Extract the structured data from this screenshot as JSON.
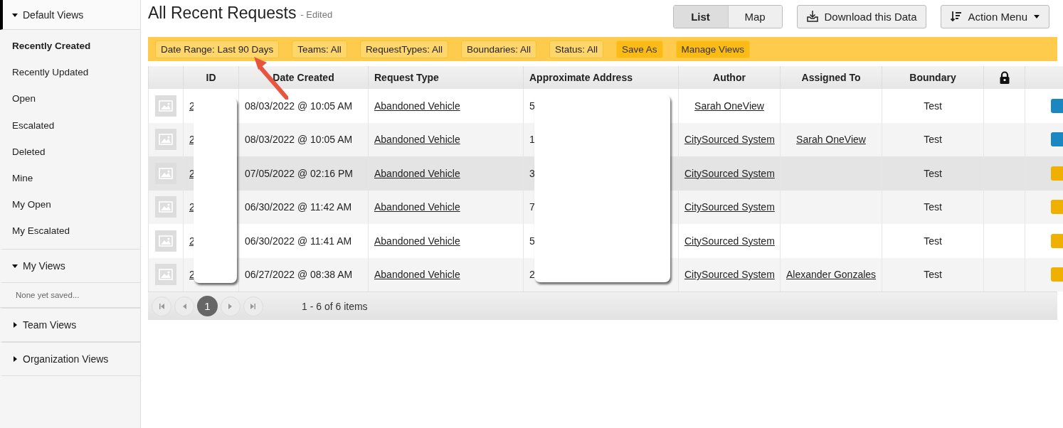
{
  "sidebar": {
    "sections": [
      {
        "title": "Default Views",
        "expanded": true,
        "active": true,
        "items": [
          {
            "label": "Recently Created",
            "selected": true
          },
          {
            "label": "Recently Updated",
            "selected": false
          },
          {
            "label": "Open",
            "selected": false
          },
          {
            "label": "Escalated",
            "selected": false
          },
          {
            "label": "Deleted",
            "selected": false
          },
          {
            "label": "Mine",
            "selected": false
          },
          {
            "label": "My Open",
            "selected": false
          },
          {
            "label": "My Escalated",
            "selected": false
          }
        ]
      },
      {
        "title": "My Views",
        "expanded": true,
        "active": false,
        "empty_text": "None yet saved..."
      },
      {
        "title": "Team Views",
        "expanded": false,
        "active": false
      },
      {
        "title": "Organization Views",
        "expanded": false,
        "active": false
      }
    ]
  },
  "header": {
    "title": "All Recent Requests",
    "subtitle": "- Edited",
    "view_toggle": [
      {
        "label": "List",
        "selected": true
      },
      {
        "label": "Map",
        "selected": false
      }
    ],
    "download_button": "Download this Data",
    "action_menu": "Action Menu"
  },
  "filters": [
    {
      "label": "Date Range: Last 90 Days",
      "kind": "filter"
    },
    {
      "label": "Teams: All",
      "kind": "filter"
    },
    {
      "label": "RequestTypes: All",
      "kind": "filter"
    },
    {
      "label": "Boundaries: All",
      "kind": "filter"
    },
    {
      "label": "Status: All",
      "kind": "filter"
    },
    {
      "label": "Save As",
      "kind": "action"
    },
    {
      "label": "Manage Views",
      "kind": "action"
    }
  ],
  "table": {
    "columns": [
      {
        "kind": "blank"
      },
      {
        "kind": "text",
        "label": "ID"
      },
      {
        "kind": "text",
        "label": "Date Created"
      },
      {
        "kind": "text",
        "label": "Request Type"
      },
      {
        "kind": "text",
        "label": "Approximate Address"
      },
      {
        "kind": "text",
        "label": "Author"
      },
      {
        "kind": "text",
        "label": "Assigned To"
      },
      {
        "kind": "text",
        "label": "Boundary"
      },
      {
        "kind": "lock"
      },
      {
        "kind": "blank"
      }
    ],
    "rows": [
      {
        "id": "2",
        "date_created": "08/03/2022 @ 10:05 AM",
        "request_type": "Abandoned Vehicle",
        "address": "5",
        "author": "Sarah OneView",
        "assigned_to": "",
        "boundary": "Test",
        "color": "#1a87c0",
        "hovered": false
      },
      {
        "id": "2",
        "date_created": "08/03/2022 @ 10:05 AM",
        "request_type": "Abandoned Vehicle",
        "address": "1",
        "author": "CitySourced System",
        "assigned_to": "Sarah OneView",
        "boundary": "Test",
        "color": "#1a87c0",
        "hovered": false
      },
      {
        "id": "2",
        "date_created": "07/05/2022 @ 02:16 PM",
        "request_type": "Abandoned Vehicle",
        "address": "3",
        "author": "CitySourced System",
        "assigned_to": "",
        "boundary": "Test",
        "color": "#f0b000",
        "hovered": true
      },
      {
        "id": "2",
        "date_created": "06/30/2022 @ 11:42 AM",
        "request_type": "Abandoned Vehicle",
        "address": "7",
        "author": "CitySourced System",
        "assigned_to": "",
        "boundary": "Test",
        "color": "#f0b000",
        "hovered": false
      },
      {
        "id": "2",
        "date_created": "06/30/2022 @ 11:41 AM",
        "request_type": "Abandoned Vehicle",
        "address": "5",
        "author": "CitySourced System",
        "assigned_to": "",
        "boundary": "Test",
        "color": "#f0b000",
        "hovered": false
      },
      {
        "id": "2",
        "date_created": "06/27/2022 @ 08:38 AM",
        "request_type": "Abandoned Vehicle",
        "address": "2",
        "author": "CitySourced System",
        "assigned_to": "Alexander Gonzales",
        "boundary": "Test",
        "color": "#f0b000",
        "hovered": false
      }
    ]
  },
  "pager": {
    "pages": [
      {
        "label": "1",
        "selected": true
      }
    ],
    "info": "1 - 6 of 6 items"
  }
}
